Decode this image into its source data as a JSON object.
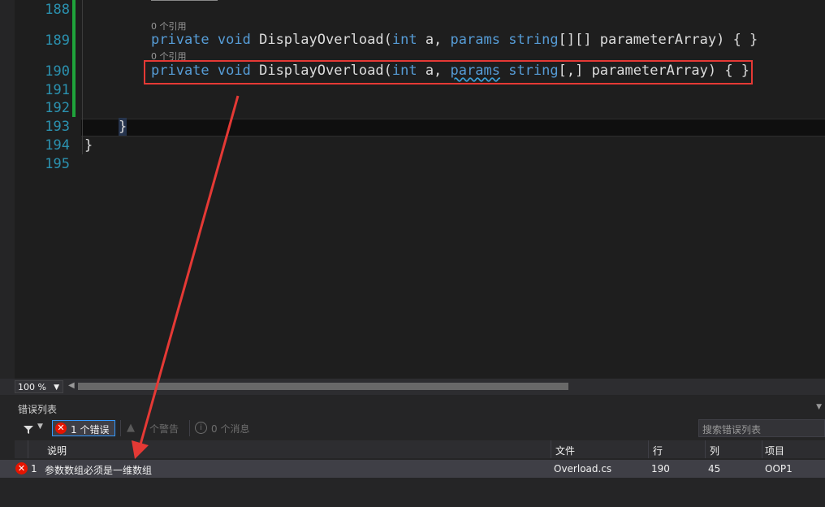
{
  "editor": {
    "line_numbers": [
      "188",
      "189",
      "190",
      "191",
      "192",
      "193",
      "194",
      "195"
    ],
    "refs_189": "0 个引用",
    "refs_190": "0 个引用",
    "line189": {
      "kw1": "private",
      "kw2": "void",
      "name": " DisplayOverload(",
      "kw3": "int",
      "mid": " a, ",
      "kw4": "params",
      "kw5": "string",
      "rest": "[][] parameterArray)",
      "braces": " { }"
    },
    "line190": {
      "kw1": "private",
      "kw2": "void",
      "name": " DisplayOverload(",
      "kw3": "int",
      "mid": " a, ",
      "kw4": "params",
      "kw5": "string",
      "rest": "[,] parameterArray)",
      "braces": " { }"
    },
    "line193": "}",
    "line194": "}"
  },
  "statusbar": {
    "zoom": "100 %"
  },
  "error_list": {
    "title": "错误列表",
    "errors_button": "1 个错误",
    "warnings_button": "个警告",
    "messages_button": "0 个消息",
    "search_placeholder": "搜索错误列表",
    "columns": [
      "说明",
      "文件",
      "行",
      "列",
      "项目"
    ],
    "rows": [
      {
        "index": "1",
        "description": "参数数组必须是一维数组",
        "file": "Overload.cs",
        "line": "190",
        "column": "45",
        "project": "OOP1"
      }
    ]
  },
  "colors": {
    "keyword": "#569cd6",
    "line_number": "#2b91af",
    "change_bar": "#1fa33b",
    "highlight_box": "#e53935",
    "error": "#e51400"
  }
}
